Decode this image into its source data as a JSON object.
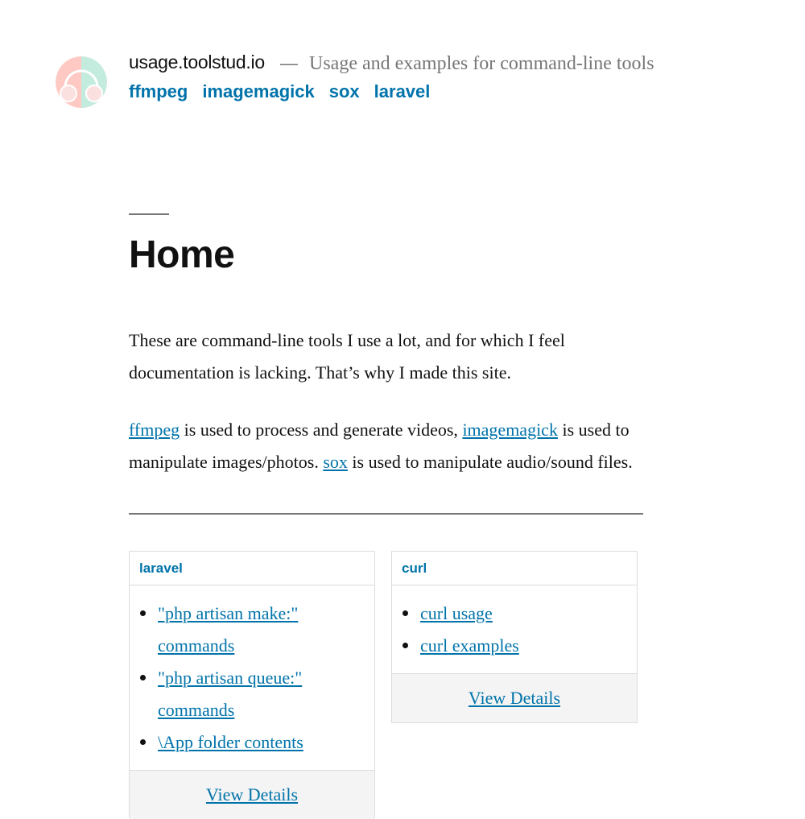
{
  "header": {
    "site_title": "usage.toolstud.io",
    "separator": "—",
    "tagline": "Usage and examples for command-line tools",
    "nav": [
      "ffmpeg",
      "imagemagick",
      "sox",
      "laravel"
    ]
  },
  "page": {
    "title": "Home",
    "intro": "These are command-line tools I use a lot, and for which I feel documentation is lacking. That’s why I made this site.",
    "tools": [
      {
        "link": "ffmpeg",
        "text": " is used to process and generate videos, "
      },
      {
        "link": "imagemagick",
        "text": " is used to manipulate images/photos. "
      },
      {
        "link": "sox",
        "text": " is used to manipulate audio/sound files."
      }
    ]
  },
  "cards": [
    {
      "title": "laravel",
      "items": [
        "\"php artisan make:\" commands",
        "\"php artisan queue:\" commands",
        "\\App folder contents"
      ],
      "footer": "View Details"
    },
    {
      "title": "curl",
      "items": [
        "curl usage",
        "curl examples"
      ],
      "footer": "View Details"
    }
  ],
  "colors": {
    "link": "#0073aa",
    "text": "#111111",
    "muted": "#767676"
  }
}
